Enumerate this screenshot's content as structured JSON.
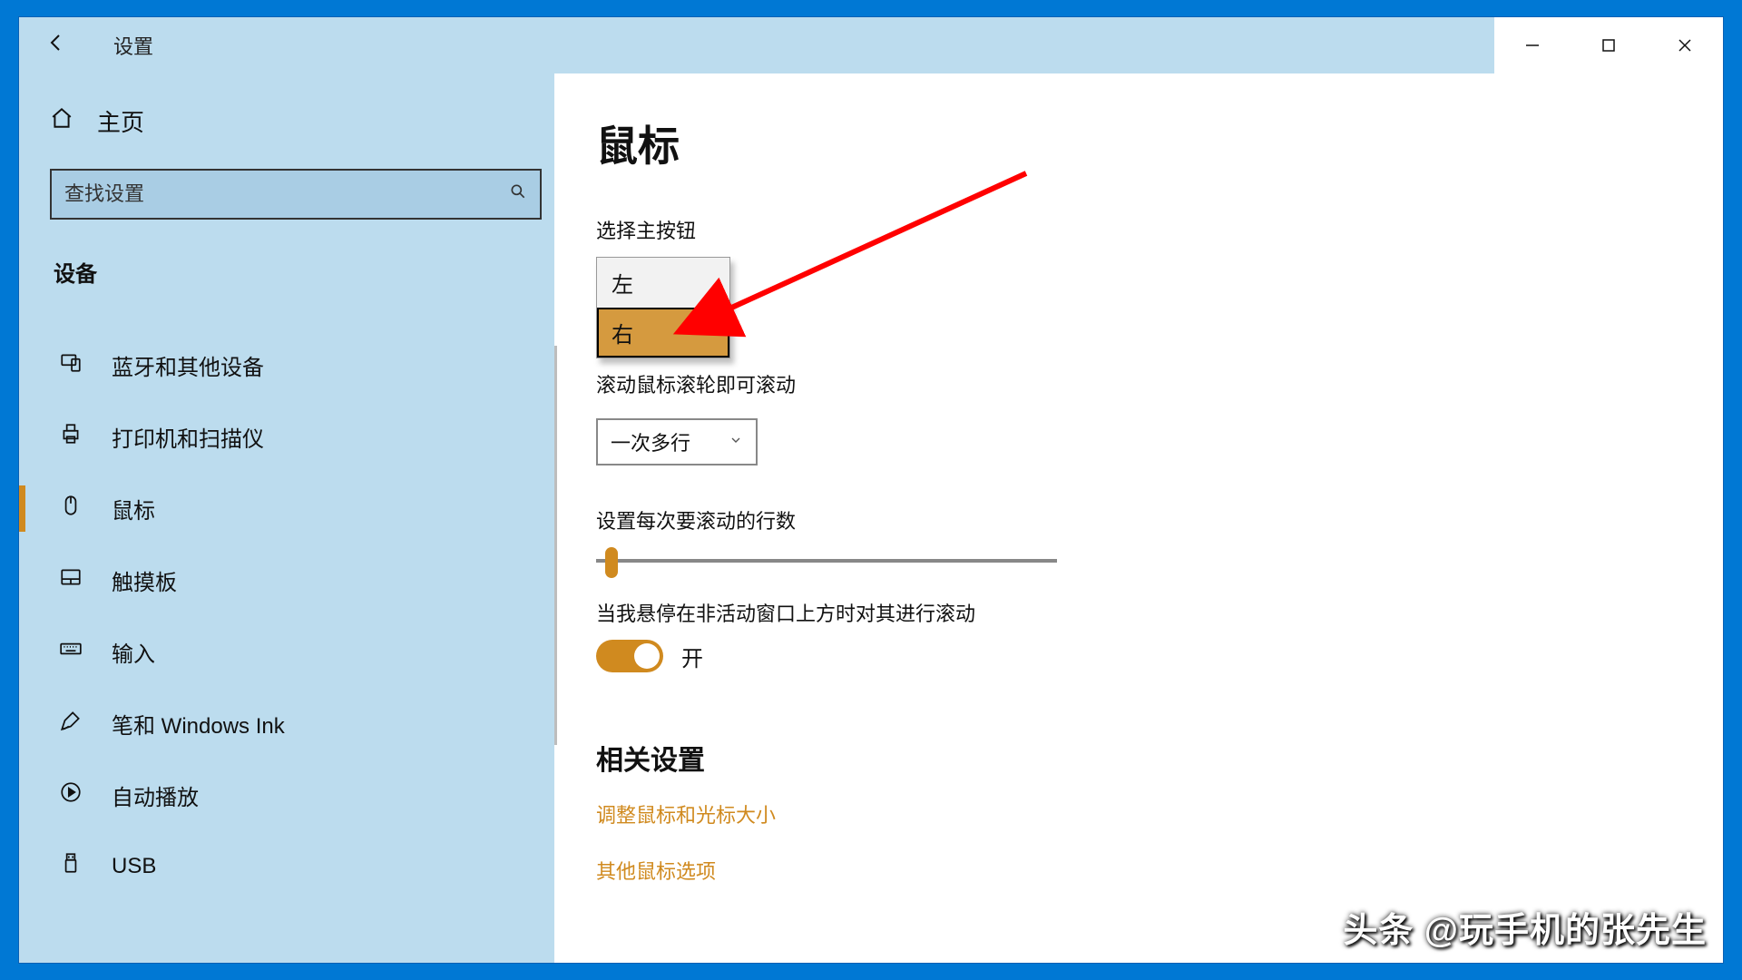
{
  "titlebar": {
    "title": "设置"
  },
  "sidebar": {
    "home": "主页",
    "search_placeholder": "查找设置",
    "section": "设备",
    "items": [
      {
        "label": "蓝牙和其他设备"
      },
      {
        "label": "打印机和扫描仪"
      },
      {
        "label": "鼠标"
      },
      {
        "label": "触摸板"
      },
      {
        "label": "输入"
      },
      {
        "label": "笔和 Windows Ink"
      },
      {
        "label": "自动播放"
      },
      {
        "label": "USB"
      }
    ]
  },
  "main": {
    "heading": "鼠标",
    "primary_button_label": "选择主按钮",
    "primary_button_options": {
      "left": "左",
      "right": "右"
    },
    "scroll_wheel_label_partial": "滚动鼠标滚轮即可滚动",
    "scroll_mode_value": "一次多行",
    "lines_label": "设置每次要滚动的行数",
    "inactive_hover_label": "当我悬停在非活动窗口上方时对其进行滚动",
    "toggle_state": "开",
    "related_heading": "相关设置",
    "link1": "调整鼠标和光标大小",
    "link2": "其他鼠标选项"
  },
  "watermark": "头条 @玩手机的张先生"
}
